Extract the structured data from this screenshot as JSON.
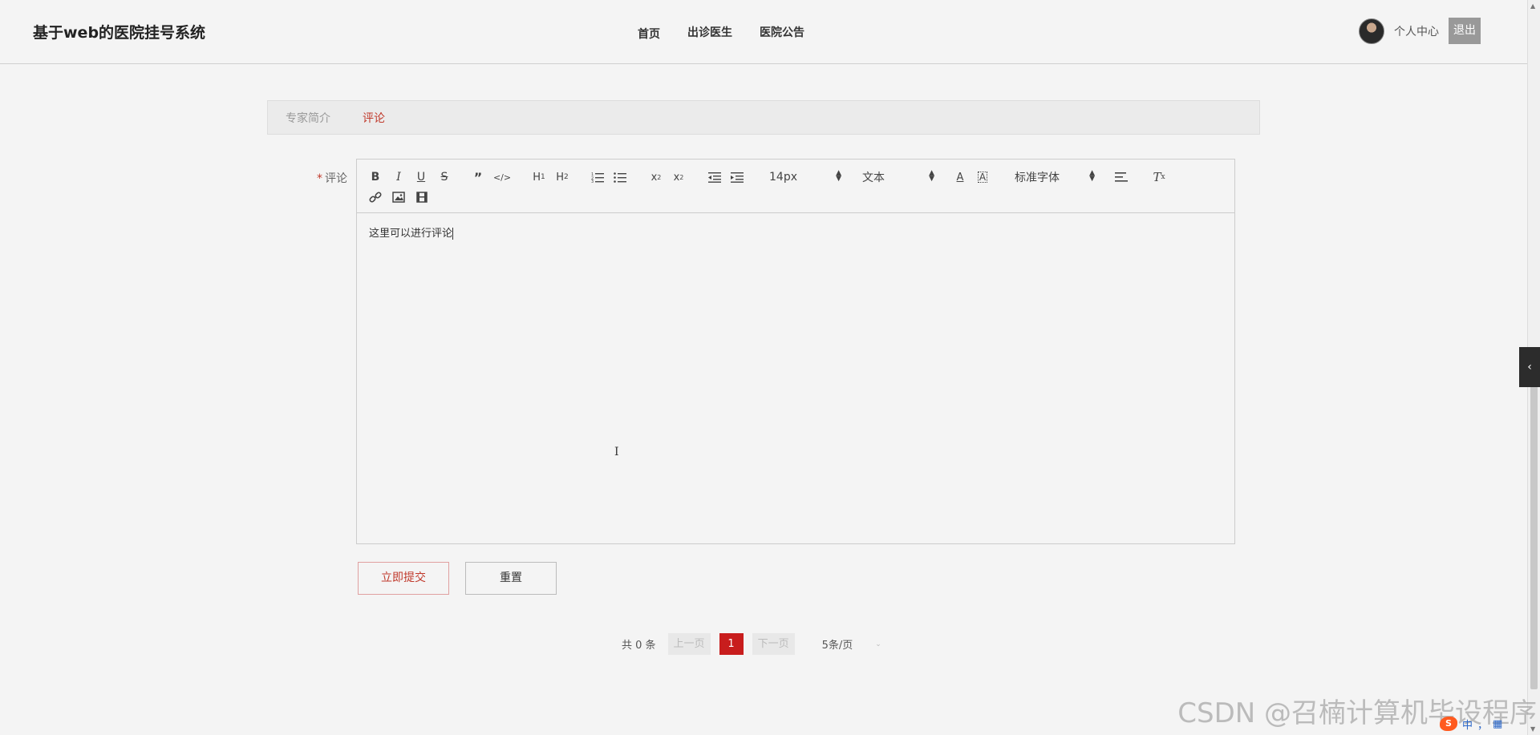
{
  "header": {
    "title": "基于web的医院挂号系统",
    "nav": [
      "首页",
      "出诊医生",
      "医院公告"
    ],
    "user_center": "个人中心",
    "logout": "退出"
  },
  "tabs": [
    "专家简介",
    "评论"
  ],
  "form": {
    "required_mark": "*",
    "label": "评论",
    "content": "这里可以进行评论"
  },
  "toolbar": {
    "size_select": "14px",
    "header_select": "文本",
    "font_select": "标准字体"
  },
  "buttons": {
    "submit": "立即提交",
    "reset": "重置"
  },
  "pagination": {
    "total": "共 0 条",
    "prev": "上一页",
    "page": "1",
    "next": "下一页",
    "page_size": "5条/页"
  },
  "watermark": "CSDN @召楠计算机毕设程序",
  "ime": {
    "logo": "S",
    "lang": "中",
    "punct": "，"
  },
  "colors": {
    "accent": "#c81d1d",
    "background": "#f4f4f4"
  }
}
